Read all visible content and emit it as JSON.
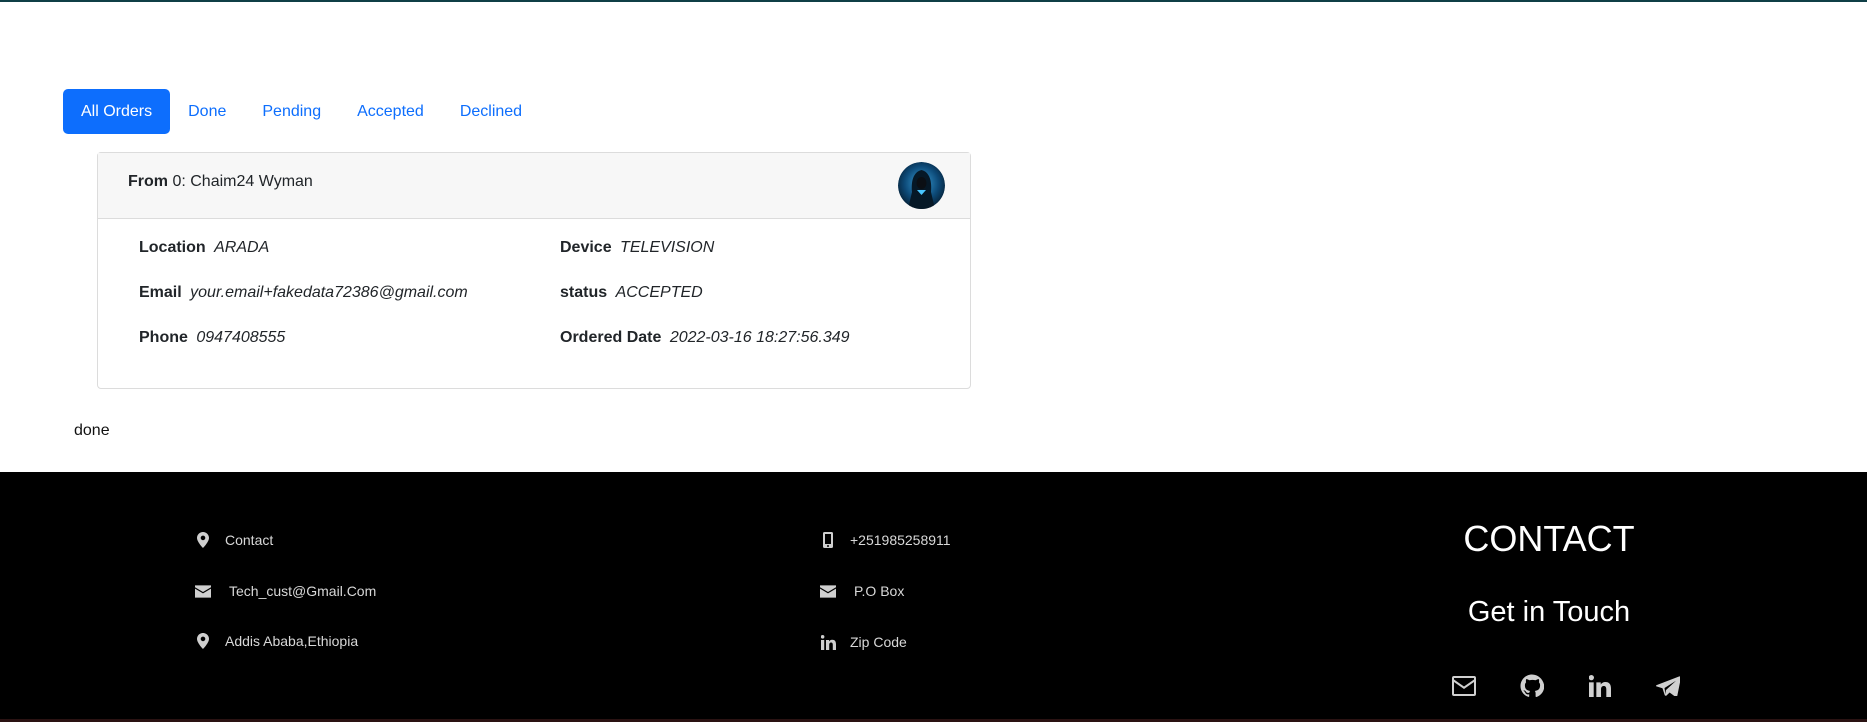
{
  "tabs": [
    {
      "label": "All Orders",
      "active": true
    },
    {
      "label": "Done"
    },
    {
      "label": "Pending"
    },
    {
      "label": "Accepted"
    },
    {
      "label": "Declined"
    }
  ],
  "order": {
    "from_label": "From",
    "from_index": "0",
    "from_name": ": Chaim24 Wyman",
    "location_label": "Location",
    "location_value": "ARADA",
    "device_label": "Device",
    "device_value": "TELEVISION",
    "email_label": "Email",
    "email_value": "your.email+fakedata72386@gmail.com",
    "status_label": "status",
    "status_value": "ACCEPTED",
    "phone_label": "Phone",
    "phone_value": "0947408555",
    "date_label": "Ordered Date",
    "date_value": "2022-03-16 18:27:56.349"
  },
  "status_text": "done",
  "footer": {
    "left": [
      {
        "icon": "map-marker-icon",
        "text": "Contact"
      },
      {
        "icon": "envelope-icon",
        "text": "Tech_cust@Gmail.Com"
      },
      {
        "icon": "map-marker-icon",
        "text": "Addis Ababa,Ethiopia"
      }
    ],
    "middle": [
      {
        "icon": "mobile-phone-icon",
        "text": "+251985258911"
      },
      {
        "icon": "envelope-icon",
        "text": "P.O Box"
      },
      {
        "icon": "linkedin-icon",
        "text": "Zip Code"
      }
    ],
    "contact_heading": "CONTACT",
    "touch_heading": "Get in Touch",
    "socials": [
      "envelope-icon",
      "github-icon",
      "linkedin-icon",
      "telegram-icon"
    ]
  },
  "colors": {
    "accent": "#0d6efd",
    "footer_bg": "#000000",
    "card_header_bg": "#f7f7f7"
  }
}
